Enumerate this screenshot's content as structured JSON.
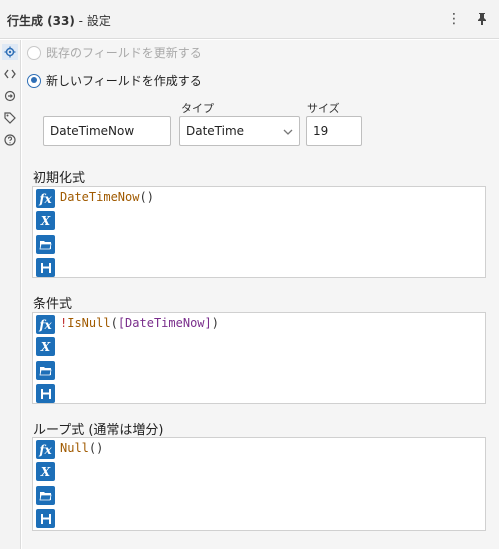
{
  "window": {
    "title_prefix": "行生成 (33)",
    "title_suffix": " - 設定"
  },
  "sidebar": {
    "icons": [
      "gear-icon",
      "code-brackets-icon",
      "connection-icon",
      "tag-icon",
      "help-icon"
    ]
  },
  "options": {
    "update_existing_label": "既存のフィールドを更新する",
    "create_new_label": "新しいフィールドを作成する",
    "selected": "create_new"
  },
  "new_field": {
    "name_value": "DateTimeNow",
    "type_label": "タイプ",
    "type_value": "DateTime",
    "size_label": "サイズ",
    "size_value": "19"
  },
  "sections": [
    {
      "title": "初期化式",
      "expr_fn": "DateTimeNow",
      "expr_open": "(",
      "expr_close": ")"
    },
    {
      "title": "条件式",
      "expr_op": "!",
      "expr_fn": "IsNull",
      "expr_open": "(",
      "expr_field": "[DateTimeNow]",
      "expr_close": ")"
    },
    {
      "title": "ループ式 (通常は増分)",
      "expr_fn": "Null",
      "expr_open": "(",
      "expr_close": ")"
    }
  ],
  "toolbar": {
    "fx_label": "fx",
    "var_label": "X"
  },
  "colors": {
    "accent": "#1d6fb8",
    "function": "#a05a00",
    "operator": "#c03030",
    "field": "#7a2e8c"
  }
}
